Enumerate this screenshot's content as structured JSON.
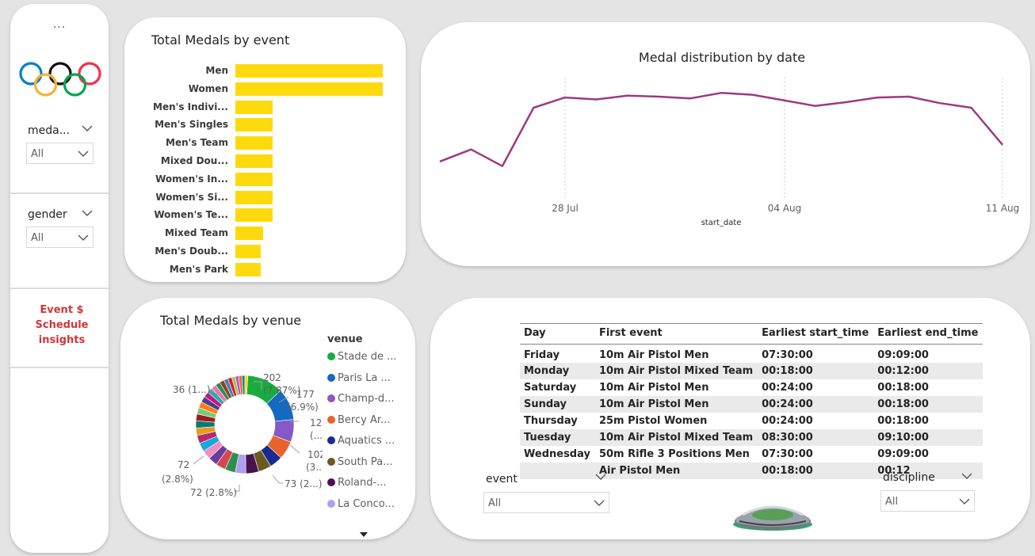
{
  "sidebar": {
    "more_label": "...",
    "slicers": [
      {
        "title": "meda...",
        "value": "All"
      },
      {
        "title": "gender",
        "value": "All"
      }
    ],
    "nav_link": "Event $ Schedule insights"
  },
  "event_chart": {
    "title": "Total Medals by event",
    "categories": [
      "Men",
      "Women",
      "Men's Indivi...",
      "Men's Singles",
      "Men's Team",
      "Mixed Dou...",
      "Women's In...",
      "Women's Si...",
      "Women's Te...",
      "Mixed Team",
      "Men's Doub...",
      "Men's Park"
    ],
    "values": [
      100,
      100,
      25,
      25,
      25,
      25,
      25,
      25,
      25,
      19,
      17,
      17
    ]
  },
  "date_chart": {
    "title": "Medal distribution by date",
    "x_label": "start_date",
    "x_ticks": [
      "28 Jul",
      "04 Aug",
      "11 Aug"
    ],
    "values": [
      42,
      55,
      37,
      100,
      111,
      109,
      113,
      112,
      110,
      116,
      114,
      108,
      102,
      106,
      111,
      112,
      105,
      100,
      60
    ]
  },
  "venue_chart": {
    "title": "Total Medals by venue",
    "legend_title": "venue",
    "legend": [
      {
        "label": "Stade de ...",
        "color": "#1aab40"
      },
      {
        "label": "Paris La ...",
        "color": "#1469c2"
      },
      {
        "label": "Champ-d...",
        "color": "#8559c7"
      },
      {
        "label": "Bercy Ar...",
        "color": "#e8622e"
      },
      {
        "label": "Aquatics ...",
        "color": "#1a2a90"
      },
      {
        "label": "South Pa...",
        "color": "#6b5a1e"
      },
      {
        "label": "Roland-...",
        "color": "#4a1250"
      },
      {
        "label": "La Conco...",
        "color": "#ad9ef0"
      }
    ],
    "data_labels": [
      "202",
      "(7.87%)",
      "177",
      "(6.9%)",
      "127",
      "(...)",
      "102",
      "(3....)",
      "73 (2...)",
      "72 (2.8%)",
      "72",
      "(2.8%)",
      "36 (1...)"
    ]
  },
  "schedule": {
    "headers": [
      "Day",
      "First event",
      "Earliest start_time",
      "Earliest end_time"
    ],
    "rows": [
      [
        "Friday",
        "10m Air Pistol Men",
        "07:30:00",
        "09:09:00"
      ],
      [
        "Monday",
        "10m Air Pistol Mixed Team",
        "00:18:00",
        "00:12:00"
      ],
      [
        "Saturday",
        "10m Air Pistol Men",
        "00:24:00",
        "00:18:00"
      ],
      [
        "Sunday",
        "10m Air Pistol Men",
        "00:24:00",
        "00:18:00"
      ],
      [
        "Thursday",
        "25m Pistol Women",
        "00:24:00",
        "00:18:00"
      ],
      [
        "Tuesday",
        "10m Air Pistol Mixed Team",
        "08:30:00",
        "09:10:00"
      ],
      [
        "Wednesday",
        "50m Rifle 3 Positions Men",
        "07:30:00",
        "09:09:00"
      ],
      [
        "",
        "Air Pistol Men",
        "00:18:00",
        "00:12"
      ]
    ],
    "event_slicer": {
      "title": "event",
      "value": "All"
    },
    "discipline_slicer": {
      "title": "discipline",
      "value": "All"
    }
  },
  "colors": {
    "bar": "#fdda0d",
    "line": "#9b3a84",
    "accent": "#d13438"
  }
}
